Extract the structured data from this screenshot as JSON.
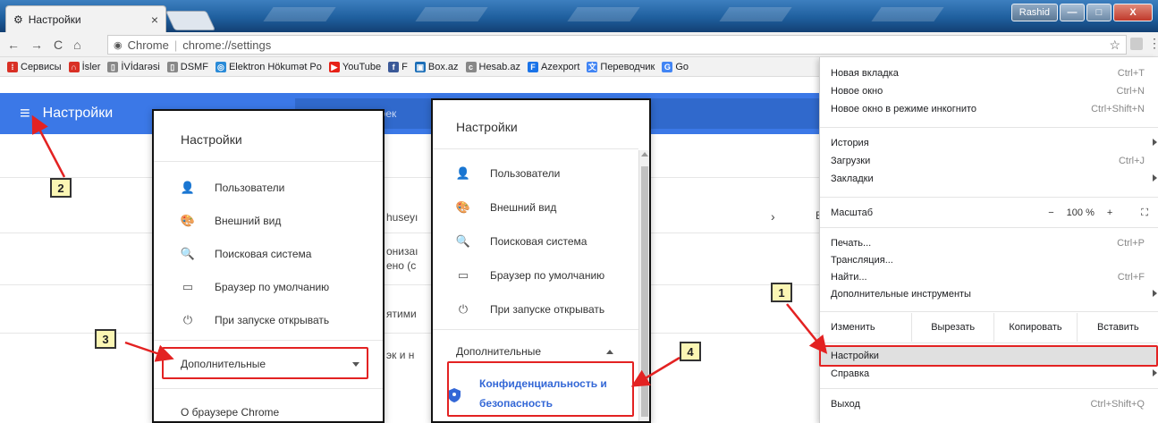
{
  "window": {
    "tab_title": "Настройки",
    "tab_close": "×",
    "user": "Rashid",
    "min": "—",
    "max": "□",
    "close": "X"
  },
  "toolbar": {
    "back": "←",
    "forward": "→",
    "reload": "C",
    "home": "⌂",
    "site_label": "Chrome",
    "separator": "|",
    "url": "chrome://settings",
    "star": "☆",
    "menu_icon": "⋮"
  },
  "bookmarks": [
    {
      "label": "Сервисы",
      "icon": "apps-icon",
      "color": "#d93025"
    },
    {
      "label": "İsler",
      "icon": "rainbow-icon",
      "color": "#d93025"
    },
    {
      "label": "İVİdarəsi",
      "icon": "page-icon",
      "color": "#888888"
    },
    {
      "label": "DSMF",
      "icon": "page-icon",
      "color": "#888888"
    },
    {
      "label": "Elektron Hökumət Po",
      "icon": "globe-icon",
      "color": "#2a8bd8"
    },
    {
      "label": "YouTube",
      "icon": "youtube-icon",
      "color": "#e62117"
    },
    {
      "label": "F",
      "icon": "facebook-icon",
      "color": "#3b5998"
    },
    {
      "label": "Box.az",
      "icon": "box-icon",
      "color": "#1c6fb8"
    },
    {
      "label": "Hesab.az",
      "icon": "hesab-icon",
      "color": "#888888"
    },
    {
      "label": "Azexport",
      "icon": "azexport-icon",
      "color": "#1a73e8"
    },
    {
      "label": "Переводчик",
      "icon": "translate-icon",
      "color": "#4285f4"
    },
    {
      "label": "Go",
      "icon": "google-icon",
      "color": "#4285f4"
    }
  ],
  "settings_page": {
    "title": "Настройки",
    "menu_icon": "≡",
    "search_text": "роек",
    "bg_texts": [
      "huseyı",
      "онизаı",
      "ено (с",
      "ятими",
      "эк и н"
    ],
    "bg_chevron": "›",
    "bg_e": "Е"
  },
  "panel_left": {
    "title": "Настройки",
    "items": [
      {
        "label": "Пользователи",
        "icon": "person-icon",
        "glyph": "👤"
      },
      {
        "label": "Внешний вид",
        "icon": "palette-icon",
        "glyph": "🎨"
      },
      {
        "label": "Поисковая система",
        "icon": "search-icon",
        "glyph": "🔍"
      },
      {
        "label": "Браузер по умолчанию",
        "icon": "browser-icon",
        "glyph": "▭"
      },
      {
        "label": "При запуске открывать",
        "icon": "power-icon",
        "glyph": "⏻"
      }
    ],
    "advanced": "Дополнительные",
    "about": "О браузере Chrome"
  },
  "panel_right": {
    "title": "Настройки",
    "items": [
      {
        "label": "Пользователи",
        "icon": "person-icon",
        "glyph": "👤"
      },
      {
        "label": "Внешний вид",
        "icon": "palette-icon",
        "glyph": "🎨"
      },
      {
        "label": "Поисковая система",
        "icon": "search-icon",
        "glyph": "🔍"
      },
      {
        "label": "Браузер по умолчанию",
        "icon": "browser-icon",
        "glyph": "▭"
      },
      {
        "label": "При запуске открывать",
        "icon": "power-icon",
        "glyph": "⏻"
      }
    ],
    "advanced": "Дополнительные",
    "privacy_line1": "Конфиденциальность и",
    "privacy_line2": "безопасность",
    "privacy_icon": "shield-icon",
    "privacy_color": "#3367d6"
  },
  "chrome_menu": {
    "group1": [
      {
        "label": "Новая вкладка",
        "shortcut": "Ctrl+T"
      },
      {
        "label": "Новое окно",
        "shortcut": "Ctrl+N"
      },
      {
        "label": "Новое окно в режиме инкогнито",
        "shortcut": "Ctrl+Shift+N"
      }
    ],
    "group2": [
      {
        "label": "История",
        "shortcut": ""
      },
      {
        "label": "Загрузки",
        "shortcut": "Ctrl+J"
      },
      {
        "label": "Закладки",
        "shortcut": ""
      }
    ],
    "zoom": {
      "label": "Масштаб",
      "minus": "−",
      "value": "100 %",
      "plus": "+",
      "fullscreen": "⛶"
    },
    "group3": [
      {
        "label": "Печать...",
        "shortcut": "Ctrl+P"
      },
      {
        "label": "Трансляция...",
        "shortcut": ""
      },
      {
        "label": "Найти...",
        "shortcut": "Ctrl+F"
      },
      {
        "label": "Дополнительные инструменты",
        "shortcut": ""
      }
    ],
    "edit": {
      "label": "Изменить",
      "cut": "Вырезать",
      "copy": "Копировать",
      "paste": "Вставить"
    },
    "settings": "Настройки",
    "help": "Справка",
    "exit": {
      "label": "Выход",
      "shortcut": "Ctrl+Shift+Q"
    }
  },
  "callouts": [
    "1",
    "2",
    "3",
    "4"
  ],
  "colors": {
    "accent": "#3b78e7",
    "callout_red": "#e32222",
    "callout_fill": "#fbf6b4"
  }
}
